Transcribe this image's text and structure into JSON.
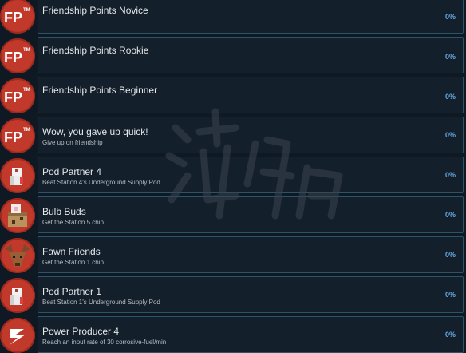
{
  "achievements": [
    {
      "title": "Friendship Points Novice",
      "description": "",
      "percent": "0%",
      "icon": "fp-icon"
    },
    {
      "title": "Friendship Points Rookie",
      "description": "",
      "percent": "0%",
      "icon": "fp-icon"
    },
    {
      "title": "Friendship Points Beginner",
      "description": "",
      "percent": "0%",
      "icon": "fp-icon"
    },
    {
      "title": "Wow, you gave up quick!",
      "description": "Give up on friendship",
      "percent": "0%",
      "icon": "fp-icon"
    },
    {
      "title": "Pod Partner 4",
      "description": "Beat Station 4's Underground Supply Pod",
      "percent": "0%",
      "icon": "pod-character-icon"
    },
    {
      "title": "Bulb Buds",
      "description": "Get the Station 5 chip",
      "percent": "0%",
      "icon": "bulb-character-icon"
    },
    {
      "title": "Fawn Friends",
      "description": "Get the Station 1 chip",
      "percent": "0%",
      "icon": "fawn-character-icon"
    },
    {
      "title": "Pod Partner 1",
      "description": "Beat Station 1's Underground Supply Pod",
      "percent": "0%",
      "icon": "pod-character-icon"
    },
    {
      "title": "Power Producer 4",
      "description": "Reach an input rate of 30 corrosive-fuel/min",
      "percent": "0%",
      "icon": "lightning-icon"
    }
  ],
  "watermark": {
    "text": "游侠网"
  },
  "colors": {
    "icon_bg": "#c0392b",
    "card_border": "#2b5566",
    "percent": "#66a8e0"
  }
}
